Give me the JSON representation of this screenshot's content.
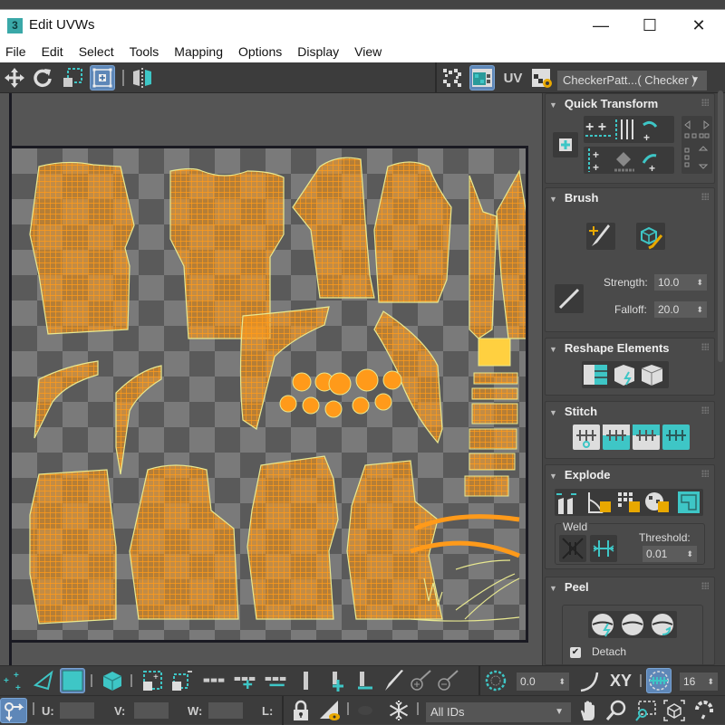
{
  "window": {
    "title": "Edit UVWs",
    "app_icon_label": "3",
    "controls": {
      "minimize": "—",
      "maximize": "☐",
      "close": "✕"
    }
  },
  "menu": [
    "File",
    "Edit",
    "Select",
    "Tools",
    "Mapping",
    "Options",
    "Display",
    "View"
  ],
  "toolbar": {
    "left_tools": [
      "move-icon",
      "rotate-icon",
      "scale-icon",
      "freeform-icon",
      "mirror-icon"
    ],
    "right_tools": [
      "checker-display-icon",
      "show-map-icon",
      "uv-toggle-icon",
      "texture-settings-icon"
    ],
    "uv_label": "UV",
    "texture_dropdown": "CheckerPatt...( Checker )"
  },
  "panels": {
    "quick_transform": {
      "title": "Quick Transform"
    },
    "brush": {
      "title": "Brush",
      "strength_label": "Strength:",
      "strength_value": "10.0",
      "falloff_label": "Falloff:",
      "falloff_value": "20.0"
    },
    "reshape_elements": {
      "title": "Reshape Elements"
    },
    "stitch": {
      "title": "Stitch"
    },
    "explode": {
      "title": "Explode",
      "weld_label": "Weld",
      "threshold_label": "Threshold:",
      "threshold_value": "0.01"
    },
    "peel": {
      "title": "Peel",
      "detach_label": "Detach",
      "detach_checked": true
    }
  },
  "bottom_toolbar": {
    "angle_value": "0.0",
    "xy_label": "XY",
    "grid_value": "16",
    "u_label": "U:",
    "v_label": "V:",
    "w_label": "W:",
    "l_label": "L:",
    "u_value": "",
    "v_value": "",
    "w_value": "",
    "id_filter": "All IDs"
  },
  "colors": {
    "accent_teal": "#3ec6c6",
    "uv_orange": "#ff9a1a",
    "selection_blue": "#5e87b8",
    "edge_yellow": "#e8e890"
  }
}
